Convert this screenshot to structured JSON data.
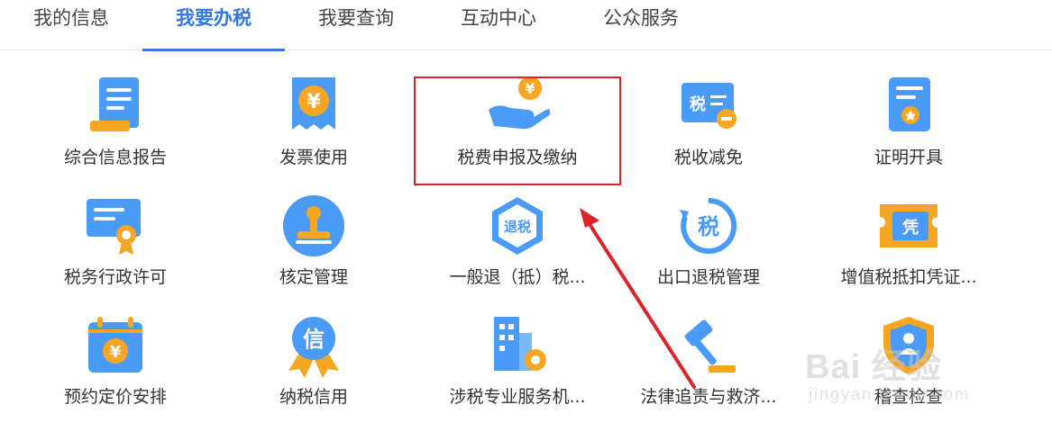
{
  "tabs": [
    {
      "label": "我的信息"
    },
    {
      "label": "我要办税",
      "active": true
    },
    {
      "label": "我要查询"
    },
    {
      "label": "互动中心"
    },
    {
      "label": "公众服务"
    }
  ],
  "services": [
    {
      "label": "综合信息报告",
      "icon": "report-document-icon"
    },
    {
      "label": "发票使用",
      "icon": "invoice-yen-icon"
    },
    {
      "label": "税费申报及缴纳",
      "icon": "hand-coin-icon"
    },
    {
      "label": "税收减免",
      "icon": "tax-reduction-icon"
    },
    {
      "label": "证明开具",
      "icon": "certificate-icon"
    },
    {
      "label": "税务行政许可",
      "icon": "license-ribbon-icon"
    },
    {
      "label": "核定管理",
      "icon": "stamp-icon"
    },
    {
      "label": "一般退（抵）税...",
      "icon": "refund-hexagon-icon"
    },
    {
      "label": "出口退税管理",
      "icon": "export-refund-icon"
    },
    {
      "label": "增值税抵扣凭证...",
      "icon": "voucher-ticket-icon"
    },
    {
      "label": "预约定价安排",
      "icon": "calendar-yen-icon"
    },
    {
      "label": "纳税信用",
      "icon": "credit-medal-icon"
    },
    {
      "label": "涉税专业服务机...",
      "icon": "building-gear-icon"
    },
    {
      "label": "法律追责与救济...",
      "icon": "gavel-icon"
    },
    {
      "label": "稽查检查",
      "icon": "shield-people-icon"
    }
  ],
  "highlighted_service": "税费申报及缴纳",
  "icon_text": {
    "invoice": "¥",
    "coin": "¥",
    "tax": "税",
    "refund": "退税",
    "export_tax": "税",
    "voucher": "凭",
    "calendar": "¥",
    "credit": "信"
  },
  "watermark": {
    "brand": "Bai 经验",
    "sub": "jingyan.baidu.com"
  },
  "colors": {
    "accent": "#3478e0",
    "icon_blue": "#4a9bf5",
    "icon_orange": "#f5a623",
    "highlight_red": "#d9242b"
  }
}
